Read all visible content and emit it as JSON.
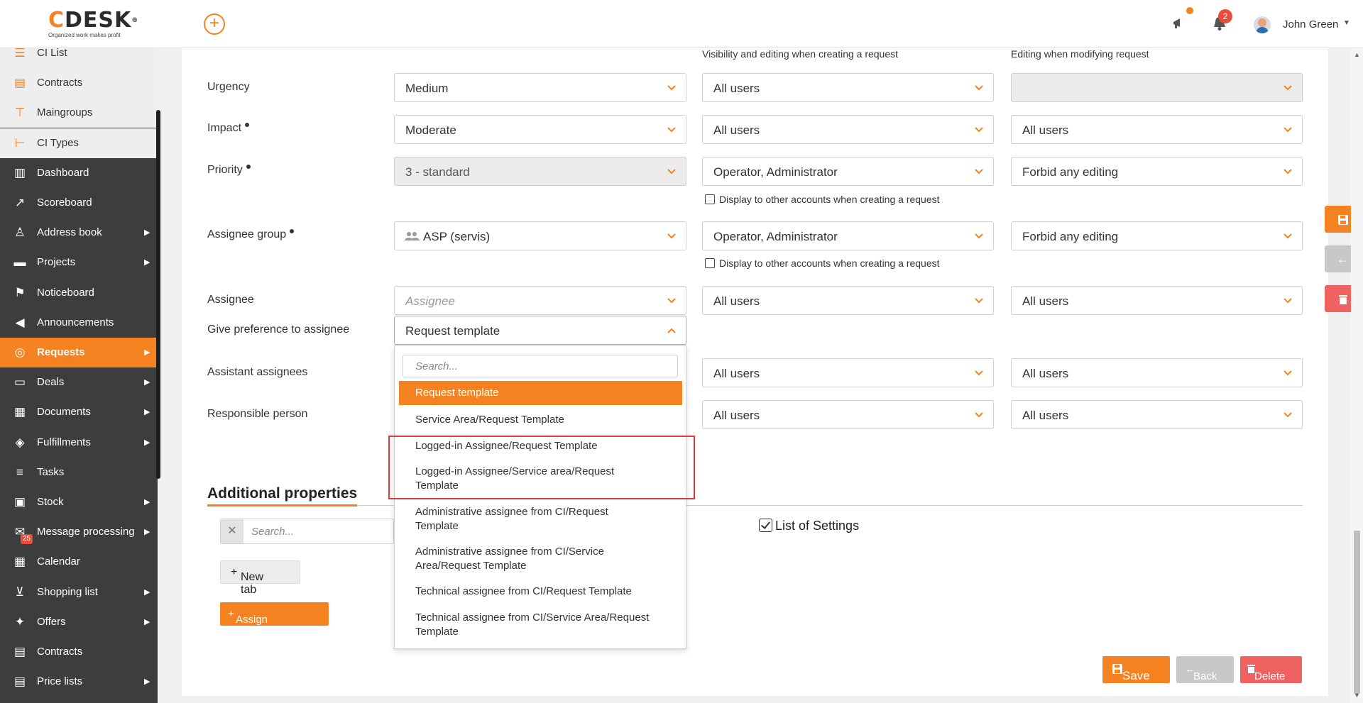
{
  "header": {
    "logo_text": "DESK",
    "logo_c": "C",
    "logo_reg": "®",
    "logo_tagline": "Organized work makes profit",
    "notification_count": "2",
    "user_name": "John Green"
  },
  "sidebar": {
    "items": [
      {
        "label": "CI List",
        "icon": "list-icon",
        "style": "light"
      },
      {
        "label": "Contracts",
        "icon": "contract-icon",
        "style": "light"
      },
      {
        "label": "Maingroups",
        "icon": "maingroups-icon",
        "style": "light"
      },
      {
        "label": "CI Types",
        "icon": "ci-types-icon",
        "style": "light"
      },
      {
        "label": "Dashboard",
        "icon": "dashboard-icon"
      },
      {
        "label": "Scoreboard",
        "icon": "scoreboard-icon"
      },
      {
        "label": "Address book",
        "icon": "person-icon",
        "submenu": true
      },
      {
        "label": "Projects",
        "icon": "projects-icon",
        "submenu": true
      },
      {
        "label": "Noticeboard",
        "icon": "noticeboard-icon"
      },
      {
        "label": "Announcements",
        "icon": "megaphone-icon"
      },
      {
        "label": "Requests",
        "icon": "requests-icon",
        "submenu": true,
        "active": true
      },
      {
        "label": "Deals",
        "icon": "deals-icon",
        "submenu": true
      },
      {
        "label": "Documents",
        "icon": "documents-icon",
        "submenu": true
      },
      {
        "label": "Fulfillments",
        "icon": "box-icon",
        "submenu": true
      },
      {
        "label": "Tasks",
        "icon": "tasks-icon"
      },
      {
        "label": "Stock",
        "icon": "stock-icon",
        "submenu": true
      },
      {
        "label": "Message processing",
        "icon": "mail-icon",
        "submenu": true,
        "badge": "25"
      },
      {
        "label": "Calendar",
        "icon": "calendar-icon"
      },
      {
        "label": "Shopping list",
        "icon": "cart-icon",
        "submenu": true
      },
      {
        "label": "Offers",
        "icon": "gift-icon",
        "submenu": true
      },
      {
        "label": "Contracts",
        "icon": "contract-icon"
      },
      {
        "label": "Price lists",
        "icon": "price-list-icon",
        "submenu": true
      }
    ]
  },
  "columns": {
    "visibility_header": "Visibility and editing when creating a request",
    "editing_header": "Editing when modifying request"
  },
  "rows": {
    "urgency": {
      "label": "Urgency",
      "value": "Medium",
      "visibility": "All users",
      "editing": ""
    },
    "impact": {
      "label": "Impact",
      "value": "Moderate",
      "visibility": "All users",
      "editing": "All users"
    },
    "priority": {
      "label": "Priority",
      "value": "3 - standard",
      "visibility": "Operator, Administrator",
      "editing": "Forbid any editing",
      "display_other": "Display to other accounts when creating a request"
    },
    "assignee_group": {
      "label": "Assignee group",
      "value": "ASP (servis)",
      "visibility": "Operator, Administrator",
      "editing": "Forbid any editing",
      "display_other": "Display to other accounts when creating a request"
    },
    "assignee": {
      "label": "Assignee",
      "placeholder": "Assignee",
      "visibility": "All users",
      "editing": "All users"
    },
    "give_preference": {
      "label": "Give preference to assignee",
      "value": "Request template"
    },
    "assistant": {
      "label": "Assistant assignees",
      "visibility": "All users",
      "editing": "All users"
    },
    "responsible": {
      "label": "Responsible person",
      "visibility": "All users",
      "editing": "All users"
    }
  },
  "dropdown": {
    "search_placeholder": "Search...",
    "options": [
      "Request template",
      "Service Area/Request Template",
      "Logged-in Assignee/Request Template",
      "Logged-in Assignee/Service area/Request Template",
      "Administrative assignee from CI/Request Template",
      "Administrative assignee from CI/Service Area/Request Template",
      "Technical assignee from CI/Request Template",
      "Technical assignee from CI/Service Area/Request Template"
    ],
    "selected": "Request template"
  },
  "additional": {
    "title": "Additional properties",
    "search_placeholder": "Search...",
    "list_of_settings": "List of Settings",
    "new_tab": "New tab",
    "assign_property": "Assign property"
  },
  "actions": {
    "save": "Save",
    "back": "Back",
    "delete": "Delete"
  },
  "colors": {
    "accent": "#f58220",
    "sidebar_bg": "#3d3d3d",
    "danger": "#f06262",
    "highlight": "#e0393e"
  }
}
